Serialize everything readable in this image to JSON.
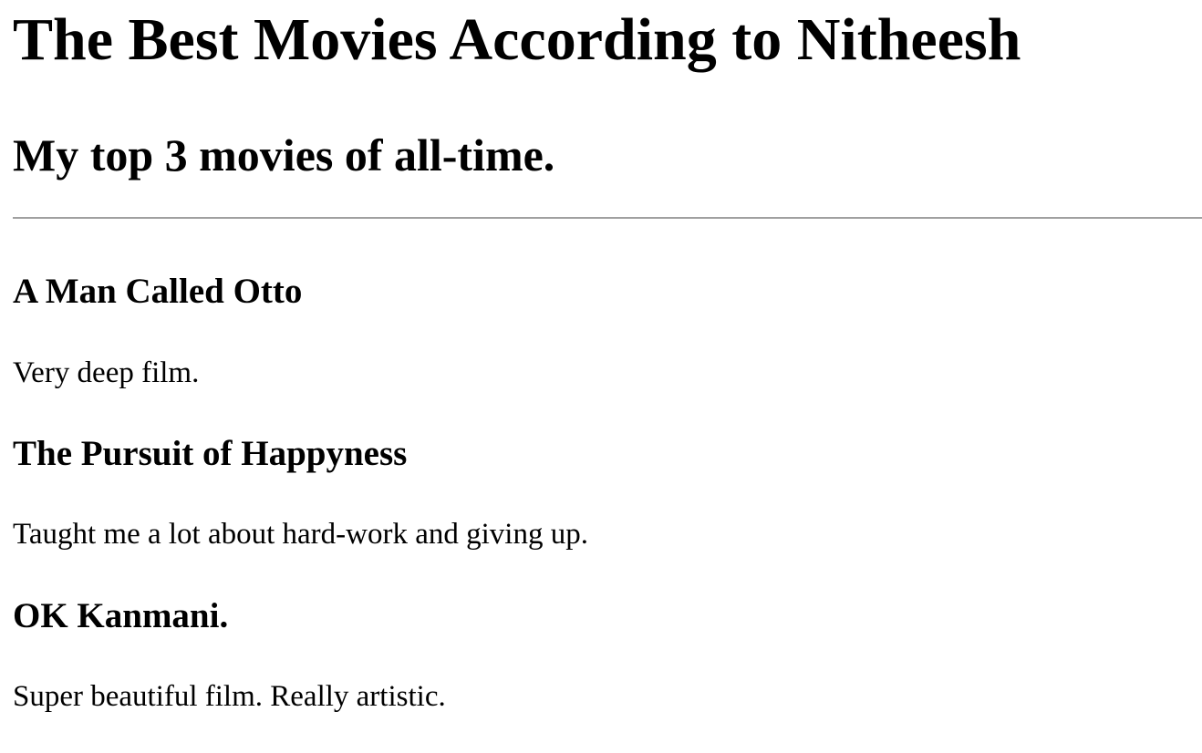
{
  "page": {
    "title": "The Best Movies According to Nitheesh",
    "subtitle": "My top 3 movies of all-time."
  },
  "movies": [
    {
      "title": "A Man Called Otto",
      "description": "Very deep film."
    },
    {
      "title": "The Pursuit of Happyness",
      "description": "Taught me a lot about hard-work and giving up."
    },
    {
      "title": "OK Kanmani.",
      "description": "Super beautiful film. Really artistic."
    }
  ],
  "colors": {
    "text": "#000000",
    "rule": "#a0a0a0",
    "background": "#ffffff"
  }
}
